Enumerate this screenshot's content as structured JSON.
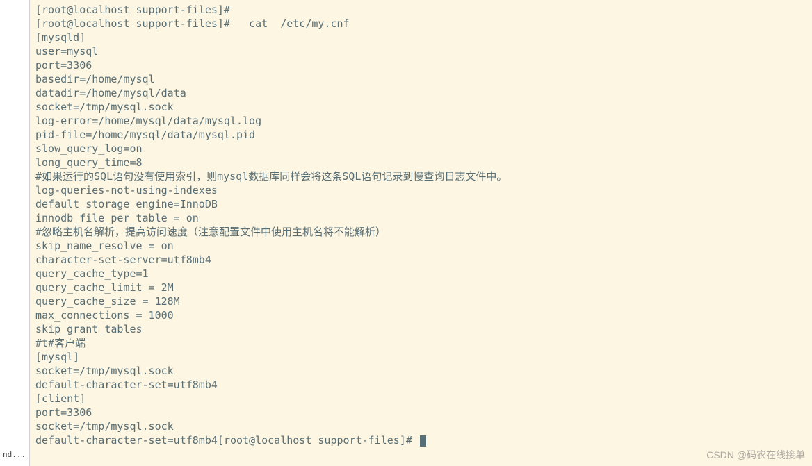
{
  "left_panel": {
    "item": "nd..."
  },
  "terminal": {
    "lines": [
      "[root@localhost support-files]#",
      "[root@localhost support-files]#   cat  /etc/my.cnf",
      "[mysqld]",
      "user=mysql",
      "port=3306",
      "basedir=/home/mysql",
      "datadir=/home/mysql/data",
      "socket=/tmp/mysql.sock",
      "log-error=/home/mysql/data/mysql.log",
      "pid-file=/home/mysql/data/mysql.pid",
      "slow_query_log=on",
      "long_query_time=8",
      "#如果运行的SQL语句没有使用索引，则mysql数据库同样会将这条SQL语句记录到慢查询日志文件中。",
      "log-queries-not-using-indexes",
      "default_storage_engine=InnoDB",
      "innodb_file_per_table = on",
      "#忽略主机名解析，提高访问速度（注意配置文件中使用主机名将不能解析）",
      "skip_name_resolve = on",
      "character-set-server=utf8mb4",
      "query_cache_type=1",
      "query_cache_limit = 2M",
      "query_cache_size = 128M",
      "max_connections = 1000",
      "skip_grant_tables",
      "#t#客户端",
      "[mysql]",
      "socket=/tmp/mysql.sock",
      "default-character-set=utf8mb4",
      "[client]",
      "port=3306",
      "socket=/tmp/mysql.sock",
      "default-character-set=utf8mb4[root@localhost support-files]# "
    ]
  },
  "watermark": "CSDN @码农在线接单"
}
